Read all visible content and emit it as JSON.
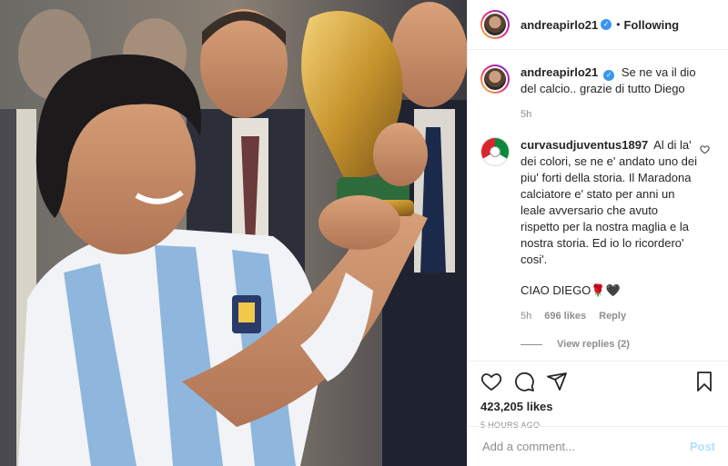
{
  "header": {
    "username": "andreapirlo21",
    "separator": "•",
    "follow_status": "Following"
  },
  "caption": {
    "username": "andreapirlo21",
    "text": "Se ne va il dio del calcio.. grazie di tutto Diego",
    "time": "5h"
  },
  "comment": {
    "username": "curvasudjuventus1897",
    "text": "Al di la' dei colori, se ne e' andato uno dei piu' forti della storia. Il Maradona calciatore e' stato per anni un leale avversario che avuto rispetto per la nostra maglia e la nostra storia. Ed io lo ricordero' cosi'.",
    "text2": "CIAO DIEGO🌹🖤",
    "time": "5h",
    "likes": "696 likes",
    "reply_label": "Reply",
    "view_replies": "View replies (2)"
  },
  "actions": {
    "likes": "423,205 likes",
    "posted_ago": "5 HOURS AGO"
  },
  "composer": {
    "placeholder": "Add a comment...",
    "post_label": "Post"
  },
  "icons": {
    "like": "heart-icon",
    "comment": "comment-icon",
    "share": "share-icon",
    "save": "bookmark-icon",
    "verified": "verified-badge-icon"
  },
  "colors": {
    "verified": "#3897f0",
    "post_button": "#b2dffc",
    "muted": "#8e8e8e"
  }
}
